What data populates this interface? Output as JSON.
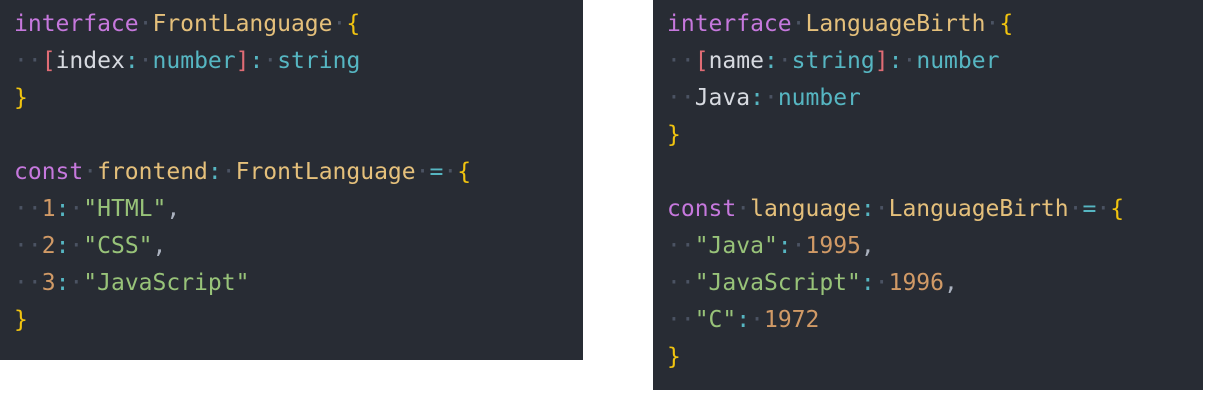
{
  "left": {
    "interface_keyword": "interface",
    "interface_name": "FrontLanguage",
    "open_brace": "{",
    "close_brace": "}",
    "index_param": "index",
    "index_type": "number",
    "value_type": "string",
    "const_keyword": "const",
    "var_name": "frontend",
    "var_type": "FrontLanguage",
    "assign": "=",
    "entries": [
      {
        "key": "1",
        "value": "\"HTML\"",
        "sep": ","
      },
      {
        "key": "2",
        "value": "\"CSS\"",
        "sep": ","
      },
      {
        "key": "3",
        "value": "\"JavaScript\"",
        "sep": ""
      }
    ]
  },
  "right": {
    "interface_keyword": "interface",
    "interface_name": "LanguageBirth",
    "open_brace": "{",
    "close_brace": "}",
    "index_param": "name",
    "index_type": "string",
    "value_type": "number",
    "prop_name": "Java",
    "prop_type": "number",
    "const_keyword": "const",
    "var_name": "language",
    "var_type": "LanguageBirth",
    "assign": "=",
    "entries": [
      {
        "key": "\"Java\"",
        "value": "1995",
        "sep": ","
      },
      {
        "key": "\"JavaScript\"",
        "value": "1996",
        "sep": ","
      },
      {
        "key": "\"C\"",
        "value": "1972",
        "sep": ""
      }
    ]
  },
  "colors": {
    "editor_background": "#282c34",
    "keyword": "#c678dd",
    "type_name": "#e5c07b",
    "brace": "#f1c40f",
    "string": "#98c379",
    "number": "#d19a66",
    "builtin_type": "#56b6c2",
    "index_bracket": "#e06c75"
  }
}
